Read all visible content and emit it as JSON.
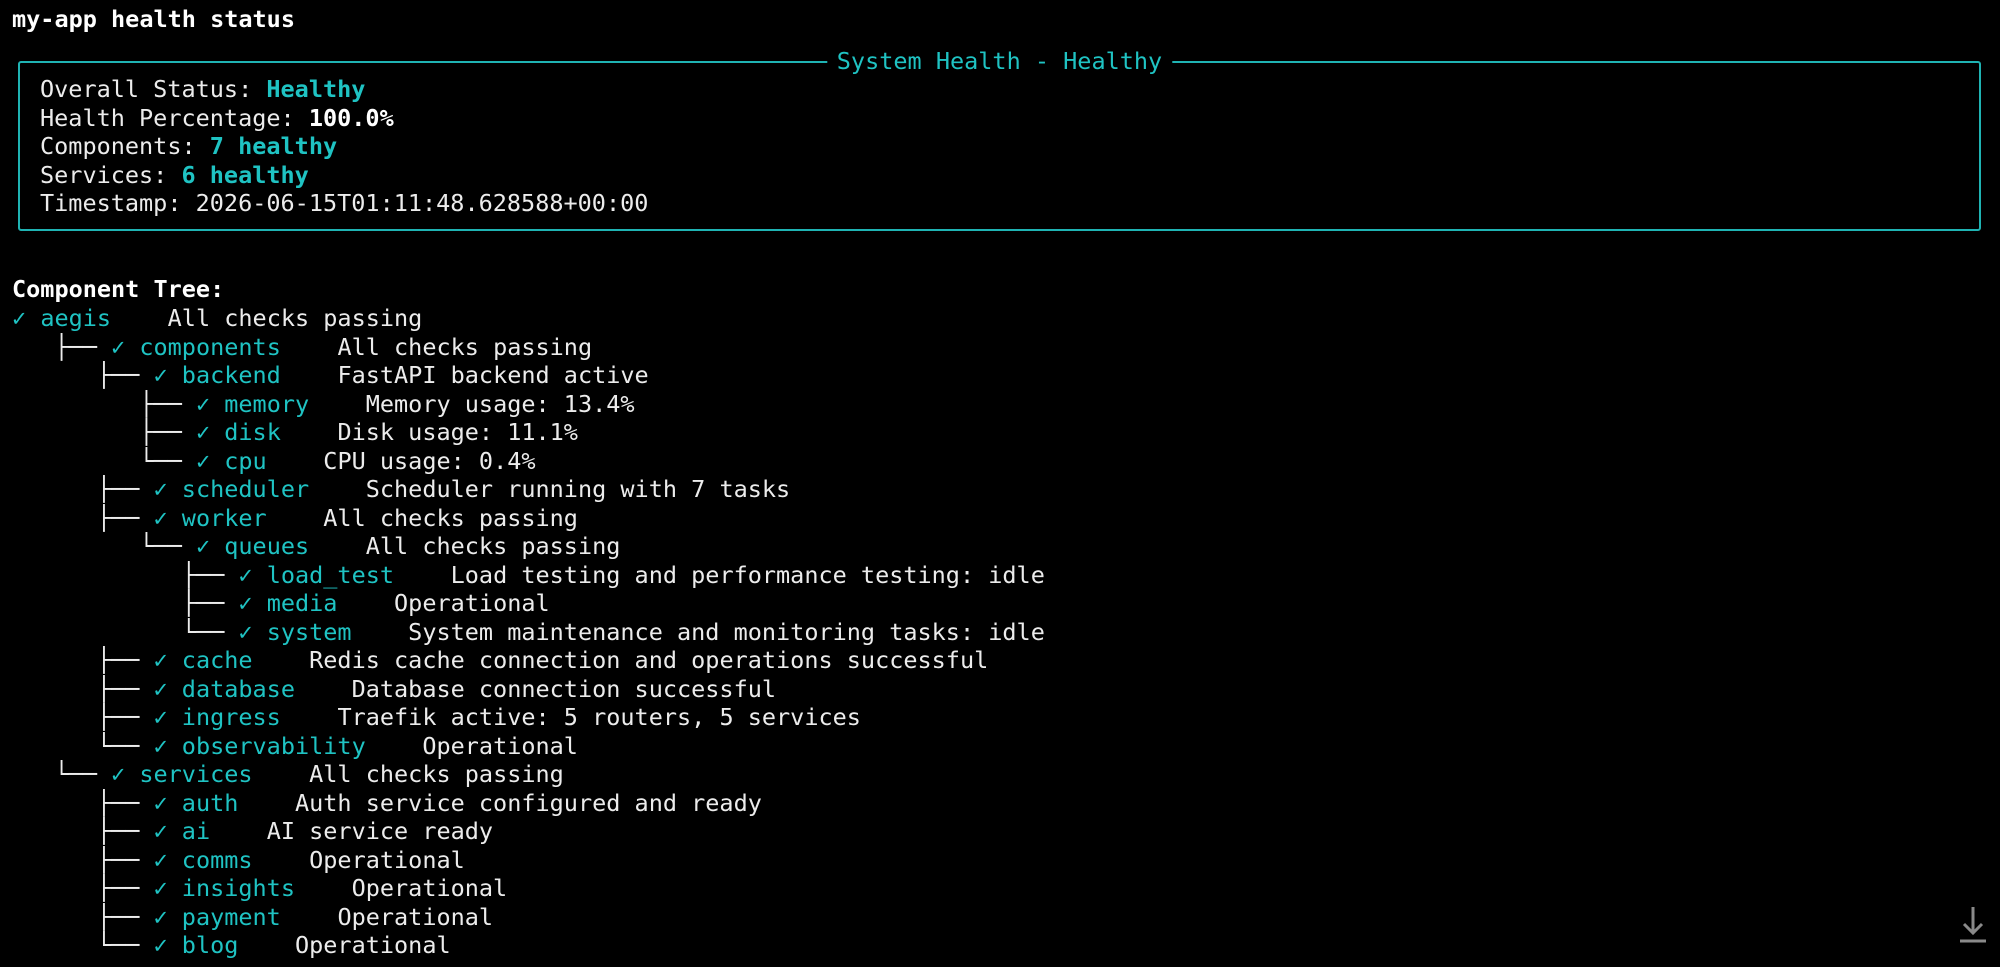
{
  "title": "my-app health status",
  "panel": {
    "title": "System Health - Healthy",
    "rows": [
      {
        "label": "Overall Status: ",
        "value": "Healthy",
        "style": "teal-bold"
      },
      {
        "label": "Health Percentage: ",
        "value": "100.0%",
        "style": "bold"
      },
      {
        "label": "Components: ",
        "value": "7 healthy",
        "style": "teal-bold"
      },
      {
        "label": "Services: ",
        "value": "6 healthy",
        "style": "teal-bold"
      },
      {
        "label": "Timestamp: ",
        "value": "2026-06-15T01:11:48.628588+00:00",
        "style": "plain"
      }
    ]
  },
  "tree": {
    "heading": "Component Tree:",
    "nodes": [
      {
        "prefix": "",
        "check": "✓",
        "name": "aegis",
        "message": "All checks passing"
      },
      {
        "prefix": "   ├── ",
        "check": "✓",
        "name": "components",
        "message": "All checks passing"
      },
      {
        "prefix": "      ├── ",
        "check": "✓",
        "name": "backend",
        "message": "FastAPI backend active"
      },
      {
        "prefix": "         ├── ",
        "check": "✓",
        "name": "memory",
        "message": "Memory usage: 13.4%"
      },
      {
        "prefix": "         ├── ",
        "check": "✓",
        "name": "disk",
        "message": "Disk usage: 11.1%"
      },
      {
        "prefix": "         └── ",
        "check": "✓",
        "name": "cpu",
        "message": "CPU usage: 0.4%"
      },
      {
        "prefix": "      ├── ",
        "check": "✓",
        "name": "scheduler",
        "message": "Scheduler running with 7 tasks"
      },
      {
        "prefix": "      ├── ",
        "check": "✓",
        "name": "worker",
        "message": "All checks passing"
      },
      {
        "prefix": "         └── ",
        "check": "✓",
        "name": "queues",
        "message": "All checks passing"
      },
      {
        "prefix": "            ├── ",
        "check": "✓",
        "name": "load_test",
        "message": "Load testing and performance testing: idle"
      },
      {
        "prefix": "            ├── ",
        "check": "✓",
        "name": "media",
        "message": "Operational"
      },
      {
        "prefix": "            └── ",
        "check": "✓",
        "name": "system",
        "message": "System maintenance and monitoring tasks: idle"
      },
      {
        "prefix": "      ├── ",
        "check": "✓",
        "name": "cache",
        "message": "Redis cache connection and operations successful"
      },
      {
        "prefix": "      ├── ",
        "check": "✓",
        "name": "database",
        "message": "Database connection successful"
      },
      {
        "prefix": "      ├── ",
        "check": "✓",
        "name": "ingress",
        "message": "Traefik active: 5 routers, 5 services"
      },
      {
        "prefix": "      └── ",
        "check": "✓",
        "name": "observability",
        "message": "Operational"
      },
      {
        "prefix": "   └── ",
        "check": "✓",
        "name": "services",
        "message": "All checks passing"
      },
      {
        "prefix": "      ├── ",
        "check": "✓",
        "name": "auth",
        "message": "Auth service configured and ready"
      },
      {
        "prefix": "      ├── ",
        "check": "✓",
        "name": "ai",
        "message": "AI service ready"
      },
      {
        "prefix": "      ├── ",
        "check": "✓",
        "name": "comms",
        "message": "Operational"
      },
      {
        "prefix": "      ├── ",
        "check": "✓",
        "name": "insights",
        "message": "Operational"
      },
      {
        "prefix": "      ├── ",
        "check": "✓",
        "name": "payment",
        "message": "Operational"
      },
      {
        "prefix": "      └── ",
        "check": "✓",
        "name": "blog",
        "message": "Operational"
      }
    ]
  },
  "icons": {
    "scroll_to_bottom": "arrow-down-to-line-icon"
  },
  "colors": {
    "accent": "#1fc3c3",
    "text": "#ececec",
    "background": "#000000"
  }
}
